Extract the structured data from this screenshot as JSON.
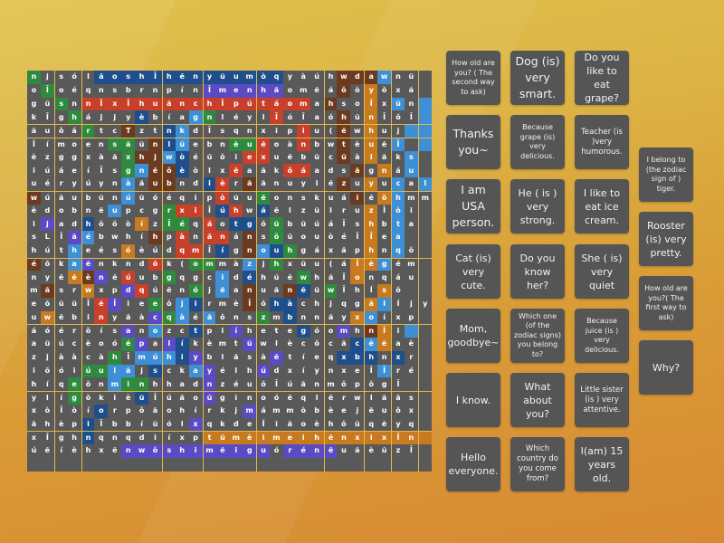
{
  "grid": {
    "rows": [
      "njsólăoshĪhĕnyŭumòqyàúhwdawnŭ",
      "oĪoéqnsbrnpínĪmenhăomĕáŏòyŏxá",
      "gŭsnnĪxĪhuănchĪpútáomahsoĪxŭn",
      "kĪghájjyèbíagnléylĪóĪaóhŭnĪŏĪ",
      "ăuŏártcTztnkdĪsqnxipiu(ĕwhuj",
      "ĬímoensăŭnlŭebnèuĕoànbwtèuĕĪ",
      "èzggxàăxhjwòéŭŏiexuĕbŭcŭàiăks",
      "iúáeíĪsgnĕŏèòlxĕaăkŏáadsăgnáu",
      "uéryúynàăubndièrăănuyiĕzuyucal",
      "wúăubŭnúŭóéqipŏŭuĕonskuáiĕŏhmm",
      "èdobnĕupcgrxiĪúhwáĕlzŭlruzĪòi",
      "ijadhŏŏòízĪéqáotgŏŭbŭúáĪshbta",
      "sLĪăébwhíhpànănánsŏŭouòéĪĪea",
      "hútheésóèúdqmĪígnouhgáxăphnqŏ",
      "éŏkaĕnkndŏk(ommàzjhxŭu(áĪĕgém",
      "nyĕĕènĕúubgqgcidéhúĕwhăĪonqáu",
      "măsrwxpdqúĕnójĕanuănĕŭwĪhĺsŏ",
      "eŏŭŭĪĕĪieeŏjirmèĪŏhàchjqgălĺjy",
      "uwĕbinyăàcqàéăŏnszmbnnăyxoíxp",
      "áóérŏísanozctpiíhetegóomhnĪi",
      "aŭúcèoóĕpalíkèmtŭwlècŏcăcĕĕaè",
      "zjààcàhĪmúhiyblăsàĕtíeqxbhnxr",
      "iŏóiúulăjsckayélhúdxíynxeĪĪré",
      "híqeŏnminhhadnzéuŏĪúănmŏpŏgĪ",
      "ylígŏkièŭĪúăoŭgĭnoóĕqlĕrwlăăs",
      "xòĪòíorpŏăohírkjmámmòbèejĕuŏx",
      "ăhèpiĪbbíŭólxqkdeĬĭăoèhŏŭqĕyq",
      "xĪghnqnqdiíxptŭmèimeihĕnxixĪn",
      "úĕíèhxĕnwŏshimĕiguórénĕuăèŭzĪ"
    ],
    "colors": [
      "eggggbbbbbbbbbbbbbbggggnnnlggg",
      "gegggggggggggppppppggggngogggg",
      "ggegrrrrrrrrrrrrrrrrrgnggoglgl",
      "gggeggggbgggleggggrggggngogggl",
      "ggggeggnggblggggggggrggngoggll",
      "ggggggeegnblgggeerggrggngoglgl",
      "gggggggennlbggggrrgggggngogglg",
      "gggggggelnnbgggrgggrrgggngoglg",
      "ggggggglgnnggbrgnggggggngoglgl",
      "ngggggglggggggrggeggggggngolgg",
      "gggggglgggerrgbrgbgggggggoglgg",
      "gpggbgggogeegrgbbgeggggggoglgg",
      "gggplggggngrgrrgngeggggggoglgg",
      "ggglgggogggrrgbgnlbegggggoglgg",
      "ngglpggggrggeegglgegggggoolgg",
      "gggonpgrggeggglgbgggegggogggg",
      "gnggoggprgggeglgnggnbgegggoggg",
      "gggggrpggeglbgggngbbgggggolggg",
      "gogggrgggpelglgggegbggggolggg",
      "gggggggpglggbggpggggbggpgnogl",
      "gggggggepgpbggggpgggggggblogg",
      "ggggggeglllbpgggggpggggbbbgbgg",
      "ggggeellgbgglpgggpgggggggglgg",
      "gggeggleeggggpgggggggggggggggg",
      "gggeggggbggggpgggggggggggggggg",
      "gggggbggggggggggpgggggggggggg",
      "ggggbgggggggpgggggggggggggggg",
      "ggggbggggggggoooooooooooooooooo",
      "gggggggpppppppppppgppppggggggg"
    ]
  },
  "cards": [
    {
      "label": "How old are you? ( The second way to ask)"
    },
    {
      "label": "Dog (is) very smart."
    },
    {
      "label": "Do you like to eat grape?"
    },
    {
      "label": "Thanks you~"
    },
    {
      "label": "Because grape (is) very delicious."
    },
    {
      "label": "Teacher (is )very humorous."
    },
    {
      "label": "I belong to (the zodiac sign of ) tiger."
    },
    {
      "label": "I am USA person."
    },
    {
      "label": "He ( is ) very strong."
    },
    {
      "label": "I like to eat ice cream."
    },
    {
      "label": "Rooster (is) very pretty."
    },
    {
      "label": "Cat (is) very cute."
    },
    {
      "label": "Do you know her?"
    },
    {
      "label": "She ( is) very quiet"
    },
    {
      "label": "How old are you?( The first way to ask)"
    },
    {
      "label": "Mom, goodbye~"
    },
    {
      "label": "Which one (of the zodiac signs) you belong to?"
    },
    {
      "label": "Because juice (is ) very delicious."
    },
    {
      "label": "Why?"
    },
    {
      "label": "I know."
    },
    {
      "label": "What about you?"
    },
    {
      "label": "Little sister (is ) very attentive."
    },
    {
      "label": "Hello everyone."
    },
    {
      "label": "Which country do you come from?"
    },
    {
      "label": "I(am) 15 years old."
    }
  ],
  "palette": {
    "g": "#595959",
    "b": "#1f4e8c",
    "l": "#3d8fd6",
    "r": "#c9402a",
    "e": "#2e8b3e",
    "p": "#5a4bc4",
    "n": "#6b3a1f",
    "o": "#c87a1f"
  }
}
